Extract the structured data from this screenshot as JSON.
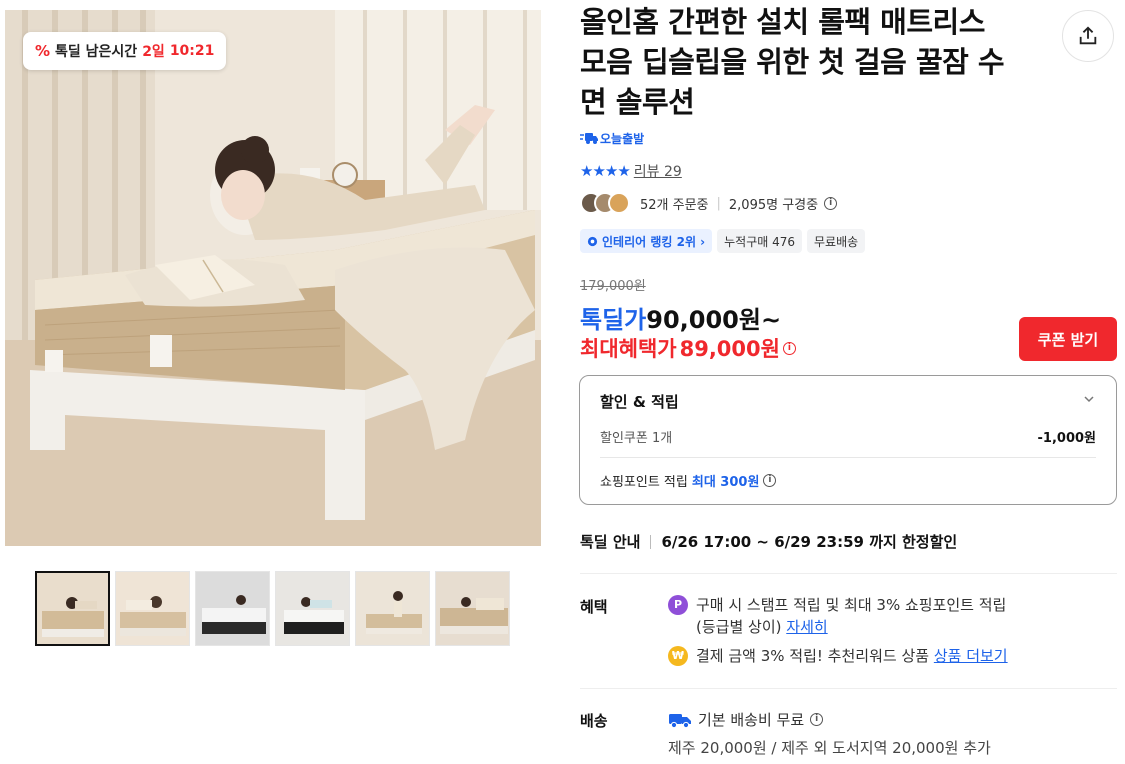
{
  "product": {
    "title": "올인홈 간편한 설치 롤팩 매트리스 모음 딥슬립을 위한 첫 걸음 꿀잠 수면 솔루션"
  },
  "gallery": {
    "timer": {
      "label": "톡딜 남은시간",
      "days": "2일",
      "time": "10:21"
    },
    "thumbnail_count": 6
  },
  "badges": {
    "today_delivery": "오늘출발"
  },
  "rating": {
    "stars": "★★★★",
    "review_text": "리뷰 29"
  },
  "social": {
    "ordering": "52개 주문중",
    "viewing": "2,095명 구경중"
  },
  "chips": [
    {
      "label": "인테리어 랭킹 2위 ›"
    },
    {
      "label": "누적구매 476"
    },
    {
      "label": "무료배송"
    }
  ],
  "price": {
    "original": "179,000원",
    "deal_label": "톡딜가",
    "deal_value": "90,000원~",
    "max_label": "최대혜택가",
    "max_value": "89,000원"
  },
  "coupon_button": "쿠폰 받기",
  "benefit_box": {
    "title": "할인 & 적립",
    "coupon_label": "할인쿠폰 1개",
    "coupon_value": "-1,000원",
    "point_label": "쇼핑포인트 적립",
    "point_value": "최대 300원"
  },
  "deal_info": {
    "label": "톡딜 안내",
    "period": "6/26 17:00 ~ 6/29 23:59 까지 한정할인"
  },
  "benefits": {
    "label": "혜택",
    "line1_text": "구매 시 스탬프 적립 및 최대 3% 쇼핑포인트 적립",
    "line1_text2": "(등급별 상이)",
    "line1_link": "자세히",
    "line2_text": "결제 금액 3% 적립! 추천리워드 상품",
    "line2_link": "상품 더보기"
  },
  "shipping": {
    "label": "배송",
    "base": "기본 배송비 무료",
    "extra": "제주 20,000원 / 제주 외 도서지역 20,000원 추가"
  },
  "colors": {
    "accent_blue": "#1e63e9",
    "accent_red": "#f0282d"
  },
  "icons": [
    "share-icon",
    "truck-icon",
    "gear-icon",
    "chevron-down-icon",
    "info-icon",
    "percent-icon"
  ]
}
